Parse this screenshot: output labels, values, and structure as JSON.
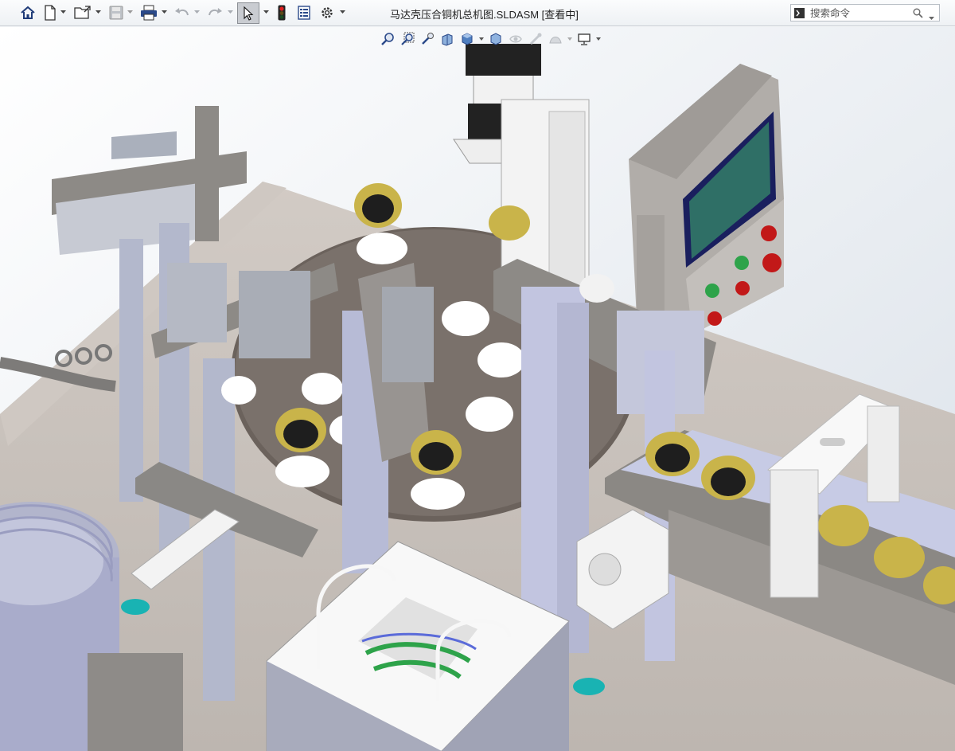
{
  "window": {
    "title": "马达壳压合铜机总机图.SLDASM [查看中]"
  },
  "search": {
    "placeholder": "搜索命令"
  },
  "toolbar": {
    "items": [
      "home-icon",
      "new-document-icon",
      "open-folder-icon",
      "save-icon",
      "print-icon",
      "undo-icon",
      "redo-icon",
      "select-pointer-icon",
      "rebuild-traffic-light-icon",
      "file-properties-icon",
      "options-gear-icon"
    ]
  },
  "heads_up_view": {
    "items": [
      "zoom-to-fit-icon",
      "zoom-to-area-icon",
      "previous-view-icon",
      "section-view-icon",
      "view-orientation-icon",
      "display-style-icon",
      "hide-show-icon",
      "edit-appearance-icon",
      "apply-scene-icon",
      "view-settings-icon"
    ]
  },
  "colors": {
    "frame_gray": "#b9bcc6",
    "lavender_part": "#c9cbe6",
    "dark_brown_table": "#6b625c",
    "screen_teal": "#2f6f66",
    "screen_bezel": "#1a1f5e",
    "brass": "#c9b44a",
    "green_button": "#2ea34a",
    "red_button": "#c21818",
    "cyan_hole": "#19b3b3",
    "white_part": "#f7f7f7"
  }
}
